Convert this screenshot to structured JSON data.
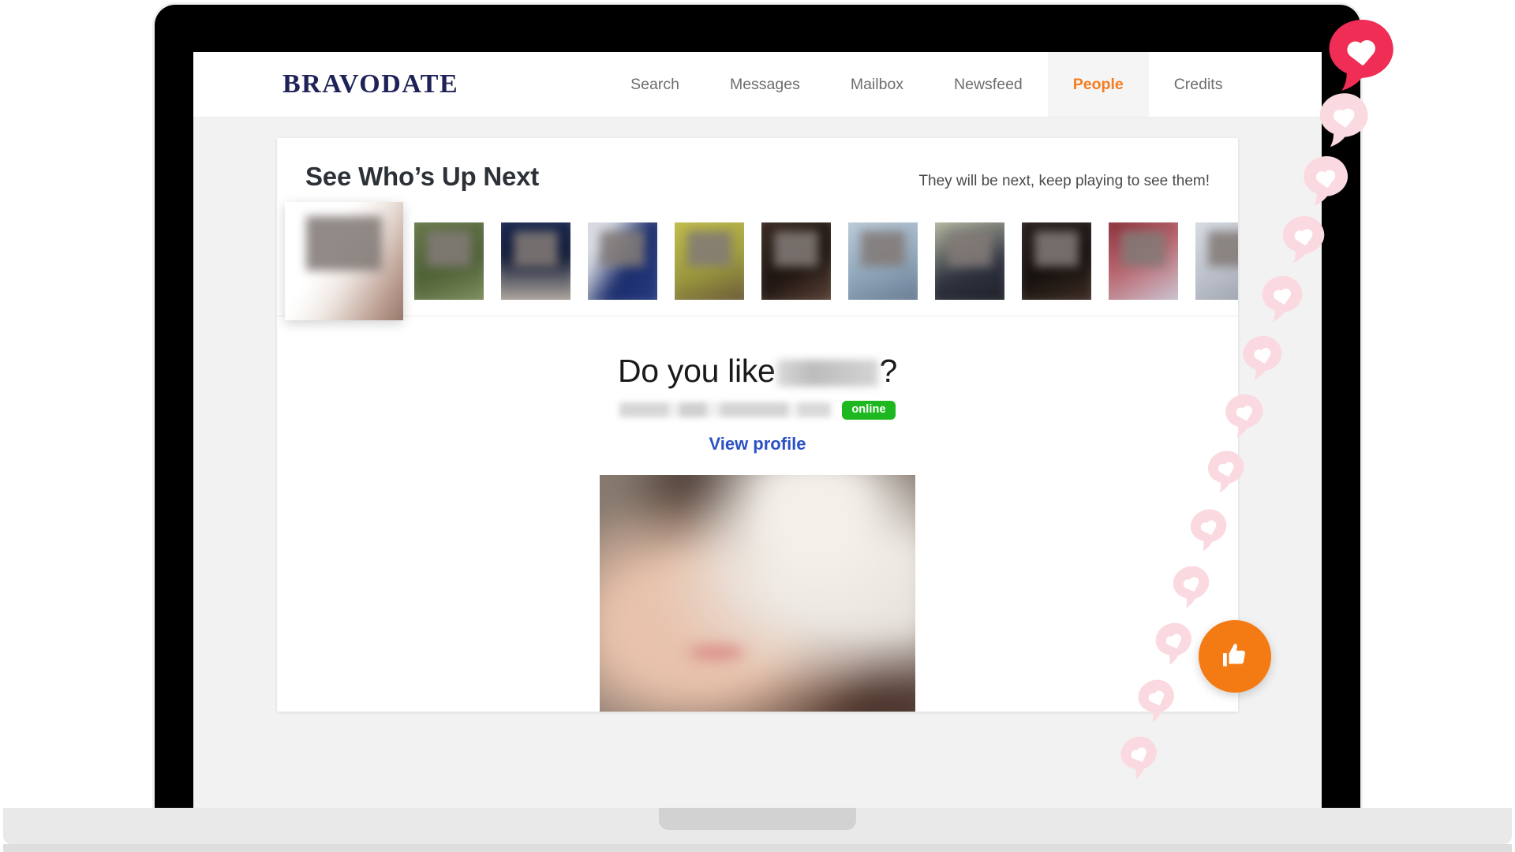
{
  "brand": {
    "logo": "BRAVODATE",
    "logo_color": "#1f2259"
  },
  "nav": {
    "items": [
      {
        "label": "Search",
        "active": false
      },
      {
        "label": "Messages",
        "active": false
      },
      {
        "label": "Mailbox",
        "active": false
      },
      {
        "label": "Newsfeed",
        "active": false
      },
      {
        "label": "People",
        "active": true
      },
      {
        "label": "Credits",
        "active": false
      }
    ],
    "active_color": "#f57c20",
    "inactive_color": "#6d6d6d",
    "active_tab_bg": "#f5f5f5"
  },
  "card": {
    "title": "See Who’s Up Next",
    "subtitle": "They will be next, keep playing to see them!"
  },
  "thumbnails": [
    {
      "name": "upcoming-profile-1",
      "featured": true,
      "bg": "linear-gradient(120deg,#ffffff 0 40%,#efe7e2 55%,#b99a8d 78%,#7c5f52)"
    },
    {
      "name": "upcoming-profile-2",
      "featured": false,
      "bg": "linear-gradient(160deg,#6e7d4e,#4d6035 55%,#8a9a68)"
    },
    {
      "name": "upcoming-profile-3",
      "featured": false,
      "bg": "linear-gradient(180deg,#1b2a55,#0d1733 45%,#cfc3b4)"
    },
    {
      "name": "upcoming-profile-4",
      "featured": false,
      "bg": "linear-gradient(120deg,#d8dbe2 0 28%,#1a2c6b 55%,#2b3f86)"
    },
    {
      "name": "upcoming-profile-5",
      "featured": false,
      "bg": "linear-gradient(160deg,#c9c44a,#9c9a3c 55%,#5e4a39)"
    },
    {
      "name": "upcoming-profile-6",
      "featured": false,
      "bg": "linear-gradient(150deg,#3c2b23,#1d1410 55%,#6b4e40)"
    },
    {
      "name": "upcoming-profile-7",
      "featured": false,
      "bg": "linear-gradient(160deg,#c5d3df,#8fa6bb 55%,#5f7288)"
    },
    {
      "name": "upcoming-profile-8",
      "featured": false,
      "bg": "linear-gradient(160deg,#cfd3b4,#2f3340 58%,#1b1d25)"
    },
    {
      "name": "upcoming-profile-9",
      "featured": false,
      "bg": "linear-gradient(160deg,#2a211d,#140f0d 55%,#4a372c)"
    },
    {
      "name": "upcoming-profile-10",
      "featured": false,
      "bg": "linear-gradient(150deg,#7f1f2b,#b8616a 45%,#cfd9e6)"
    },
    {
      "name": "upcoming-profile-11",
      "featured": false,
      "bg": "linear-gradient(150deg,#dfe4ea,#b9bec8 55%,#8d93a0)"
    }
  ],
  "profile": {
    "question_prefix": "Do you like",
    "question_suffix": "?",
    "name_redacted": true,
    "meta_redacted": true,
    "status_badge": "online",
    "status_color": "#1db820",
    "view_profile_label": "View profile",
    "view_profile_color": "#2b51c4"
  },
  "like_button": {
    "icon": "thumbs-up-icon",
    "color": "#f47b13"
  },
  "decoration": {
    "icon": "heart-speech-bubble-icon",
    "lead_color": "#ef2d55",
    "trail_color": "#fbd9e0",
    "count": 13
  }
}
